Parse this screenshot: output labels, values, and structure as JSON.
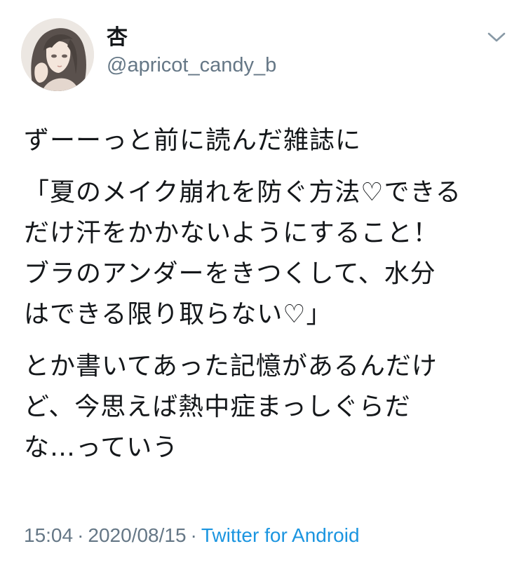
{
  "user": {
    "display_name": "杏",
    "handle": "@apricot_candy_b"
  },
  "tweet": {
    "paragraphs": [
      [
        "ずーーっと前に読んだ雑誌に"
      ],
      [
        "「夏のメイク崩れを防ぐ方法♡できる",
        "だけ汗をかかないようにすること！",
        "ブラのアンダーをきつくして、水分",
        "はできる限り取らない♡」"
      ],
      [
        "とか書いてあった記憶があるんだけ",
        "ど、今思えば熱中症まっしぐらだ",
        "な…っていう"
      ]
    ],
    "time": "15:04",
    "date": "2020/08/15",
    "separator": "·",
    "source": "Twitter for Android"
  },
  "icons": {
    "menu": "chevron-down-icon",
    "avatar": "avatar-illustration"
  },
  "colors": {
    "text": "#14171a",
    "secondary": "#657786",
    "link": "#1b95e0"
  }
}
